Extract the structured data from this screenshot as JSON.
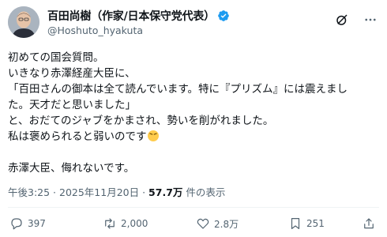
{
  "author": {
    "display_name": "百田尚樹（作家/日本保守党代表）",
    "handle": "@Hoshuto_hyakuta",
    "verified": true
  },
  "post": {
    "lines": [
      "初めての国会質問。",
      "いきなり赤澤経産大臣に、",
      "「百田さんの御本は全て読んでいます。特に『プリズム』には震えまし",
      "た。天才だと思いました」",
      "と、おだてのジャブをかまされ、勢いを削がれました。",
      "私は褒められると弱いのです",
      "",
      "赤澤大臣、侮れないです。"
    ]
  },
  "meta": {
    "time": "午後3:25",
    "separator": " · ",
    "date": "2025年11月20日",
    "views_count": "57.7万",
    "views_label": " 件の表示"
  },
  "actions": {
    "replies": "397",
    "reposts": "2,000",
    "likes": "2.8万",
    "bookmarks": "251"
  },
  "colors": {
    "verified": "#1d9bf0",
    "secondary_text": "#536471",
    "primary_text": "#0f1419"
  }
}
